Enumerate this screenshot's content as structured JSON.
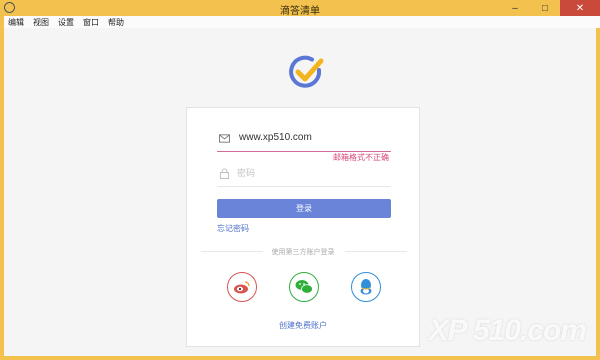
{
  "window": {
    "title": "滴答清单"
  },
  "menu": [
    "编辑",
    "视图",
    "设置",
    "窗口",
    "帮助"
  ],
  "login": {
    "email_value": "www.xp510.com",
    "email_error": "邮箱格式不正确",
    "password_placeholder": "密码",
    "login_label": "登录",
    "forgot_label": "忘记密码",
    "third_party_label": "使用第三方账户登录",
    "create_account_label": "创建免费账户"
  },
  "social": [
    {
      "name": "weibo",
      "color": "#d9534f"
    },
    {
      "name": "wechat",
      "color": "#2fae3a"
    },
    {
      "name": "qq",
      "color": "#2f8fd9"
    }
  ],
  "watermark": "XP 510.com",
  "colors": {
    "titlebar": "#f2c14e",
    "accent": "#6a84d9",
    "error": "#d94a78"
  }
}
